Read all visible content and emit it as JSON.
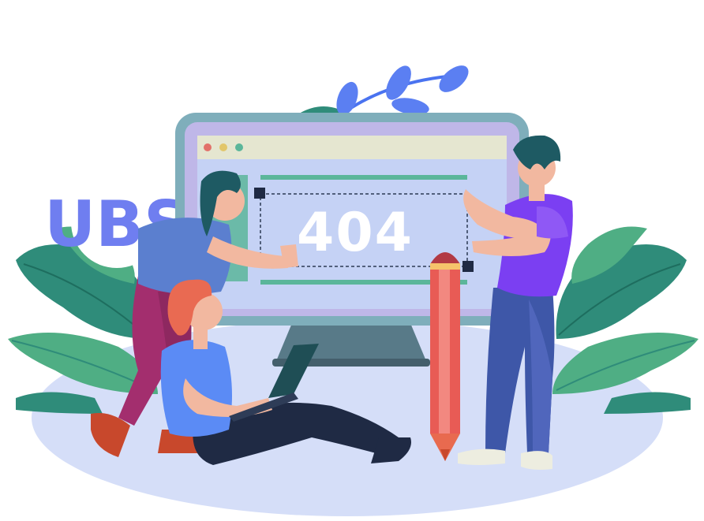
{
  "illustration": {
    "error_code": "404",
    "logo_text": "UBS"
  },
  "colors": {
    "ground": "#D5DEF8",
    "monitor_frame": "#7FAEBB",
    "screen_bg": "#BFB7E8",
    "page_bg": "#C5D2F5",
    "browser_bar": "#E5E6D0",
    "accent_green": "#5BB69A",
    "leaf_dark": "#2F8C7A",
    "leaf_light": "#4FAE84",
    "logo_blue": "#6F7EF0",
    "brand_purple": "#7B3FF2"
  },
  "icons": [
    "window-dots-icon",
    "pencil-icon",
    "laptop-icon",
    "leaf-icon",
    "ubs-logo"
  ]
}
